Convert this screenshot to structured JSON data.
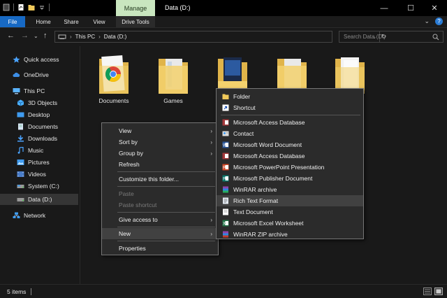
{
  "window": {
    "title": "Data (D:)",
    "manage_tab": "Manage",
    "drive_tools_tab": "Drive Tools",
    "minimize": "—",
    "maximize": "☐",
    "close": "✕"
  },
  "ribbon": {
    "tabs": [
      {
        "label": "File"
      },
      {
        "label": "Home"
      },
      {
        "label": "Share"
      },
      {
        "label": "View"
      },
      {
        "label": "Drive Tools"
      }
    ],
    "help": "?",
    "collapse": "⌄"
  },
  "address": {
    "back": "←",
    "forward": "→",
    "recent": "⌄",
    "up": "↑",
    "crumbs": [
      "This PC",
      "Data (D:)"
    ],
    "chev": "›",
    "dropdown": "⌄",
    "refresh": "↻",
    "search_placeholder": "Search Data (D:)"
  },
  "sidebar": {
    "items": [
      {
        "label": "Quick access",
        "icon": "star-icon"
      },
      {
        "label": "OneDrive",
        "icon": "cloud-icon"
      },
      {
        "label": "This PC",
        "icon": "computer-icon"
      },
      {
        "label": "3D Objects",
        "icon": "cube-icon"
      },
      {
        "label": "Desktop",
        "icon": "desktop-icon"
      },
      {
        "label": "Documents",
        "icon": "documents-icon"
      },
      {
        "label": "Downloads",
        "icon": "download-icon"
      },
      {
        "label": "Music",
        "icon": "music-icon"
      },
      {
        "label": "Pictures",
        "icon": "pictures-icon"
      },
      {
        "label": "Videos",
        "icon": "videos-icon"
      },
      {
        "label": "System (C:)",
        "icon": "drive-icon"
      },
      {
        "label": "Data (D:)",
        "icon": "drive-icon"
      },
      {
        "label": "Network",
        "icon": "network-icon"
      }
    ]
  },
  "folders": [
    {
      "label": "Documents"
    },
    {
      "label": "Games"
    },
    {
      "label": ""
    },
    {
      "label": ""
    },
    {
      "label": ""
    }
  ],
  "context_menu": {
    "items": [
      {
        "label": "View",
        "arrow": "›"
      },
      {
        "label": "Sort by",
        "arrow": "›"
      },
      {
        "label": "Group by",
        "arrow": "›"
      },
      {
        "label": "Refresh"
      },
      {
        "label": "Customize this folder..."
      },
      {
        "label": "Paste"
      },
      {
        "label": "Paste shortcut"
      },
      {
        "label": "Give access to",
        "arrow": "›"
      },
      {
        "label": "New",
        "arrow": "›"
      },
      {
        "label": "Properties"
      }
    ]
  },
  "new_submenu": {
    "items": [
      {
        "label": "Folder"
      },
      {
        "label": "Shortcut"
      },
      {
        "label": "Microsoft Access Database"
      },
      {
        "label": "Contact"
      },
      {
        "label": "Microsoft Word Document"
      },
      {
        "label": "Microsoft Access Database"
      },
      {
        "label": "Microsoft PowerPoint Presentation"
      },
      {
        "label": "Microsoft Publisher Document"
      },
      {
        "label": "WinRAR archive"
      },
      {
        "label": "Rich Text Format"
      },
      {
        "label": "Text Document"
      },
      {
        "label": "Microsoft Excel Worksheet"
      },
      {
        "label": "WinRAR ZIP archive"
      }
    ]
  },
  "status": {
    "items_count": "5 items"
  },
  "colors": {
    "background": "#191919",
    "accent": "#1769c4",
    "manage": "#c9e6bf",
    "folder": "#f0c95a"
  }
}
